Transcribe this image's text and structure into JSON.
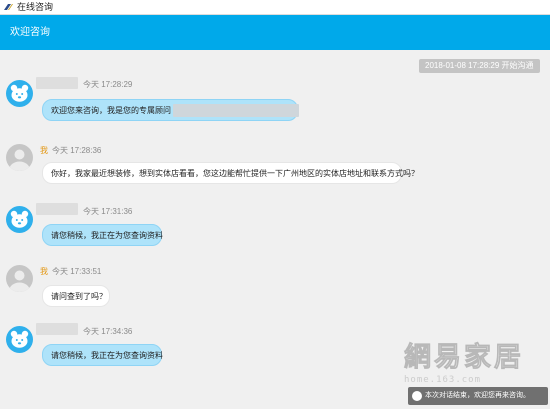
{
  "window": {
    "title": "在线咨询"
  },
  "header": {
    "heading": "欢迎咨询"
  },
  "chat": {
    "session_started": "2018-01-08 17:28:29 开始沟通",
    "messages": [
      {
        "sender": "agent",
        "time": "今天 17:28:29",
        "text": "欢迎您来咨询，我是您的专属顾问"
      },
      {
        "sender": "user",
        "name": "我",
        "time": "今天 17:28:36",
        "text": "你好，我家最近想装修，想到实体店看看，您这边能帮忙提供一下广州地区的实体店地址和联系方式吗？"
      },
      {
        "sender": "agent",
        "time": "今天 17:31:36",
        "text": "请您稍候，我正在为您查询资料"
      },
      {
        "sender": "user",
        "name": "我",
        "time": "今天 17:33:51",
        "text": "请问查到了吗？"
      },
      {
        "sender": "agent",
        "time": "今天 17:34:36",
        "text": "请您稍候，我正在为您查询资料"
      }
    ]
  },
  "watermark": {
    "logo": "網易家居",
    "url": "home.163.com"
  },
  "toast": {
    "text": "本次对话结束，欢迎您再来咨询。"
  },
  "colors": {
    "header": "#00a9ea",
    "agent_bubble": "#aee3fa",
    "user_bubble": "#ffffff",
    "user_tag": "#e39a1a",
    "background": "#f0f0f0"
  }
}
